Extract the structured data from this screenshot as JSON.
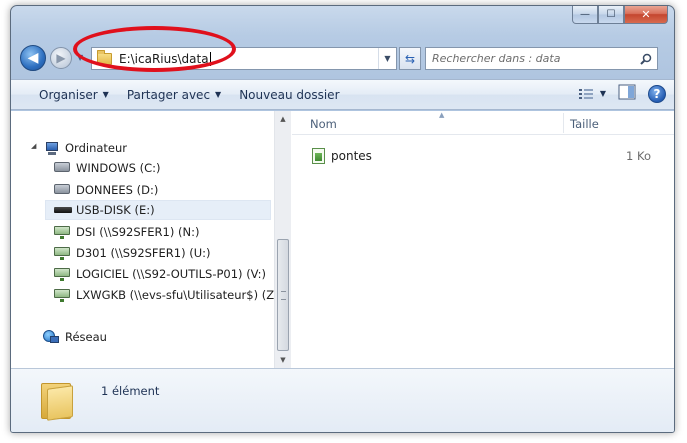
{
  "window": {
    "caption_buttons": {
      "minimize": "—",
      "maximize": "☐",
      "close": "✕"
    }
  },
  "nav": {
    "back_glyph": "◀",
    "forward_glyph": "▶",
    "recent_glyph": "▼",
    "address": "E:\\icaRius\\data",
    "address_dropdown_glyph": "▼",
    "refresh_glyph": "⇆",
    "search_placeholder": "Rechercher dans : data"
  },
  "toolbar": {
    "organize": "Organiser",
    "share": "Partager avec",
    "new_folder": "Nouveau dossier",
    "dropdown_glyph": "▼",
    "help_glyph": "?"
  },
  "sidebar": {
    "computer": "Ordinateur",
    "drives": [
      {
        "label": "WINDOWS (C:)",
        "kind": "hdd"
      },
      {
        "label": "DONNEES (D:)",
        "kind": "hdd"
      },
      {
        "label": "USB-DISK (E:)",
        "kind": "usb",
        "selected": true
      },
      {
        "label": "DSI (\\\\S92SFER1) (N:)",
        "kind": "network"
      },
      {
        "label": "D301 (\\\\S92SFER1) (U:)",
        "kind": "network"
      },
      {
        "label": "LOGICIEL (\\\\S92-OUTILS-P01) (V:)",
        "kind": "network"
      },
      {
        "label": "LXWGKB (\\\\evs-sfu\\Utilisateur$) (Z:)",
        "kind": "network"
      }
    ],
    "network": "Réseau"
  },
  "file_list": {
    "columns": {
      "name": "Nom",
      "size": "Taille"
    },
    "files": [
      {
        "name": "pontes",
        "size": "1 Ko",
        "icon": "spreadsheet-icon"
      }
    ]
  },
  "details": {
    "count": "1 élément"
  },
  "colors": {
    "annotation": "#e0101c",
    "accent": "#245cb3"
  }
}
